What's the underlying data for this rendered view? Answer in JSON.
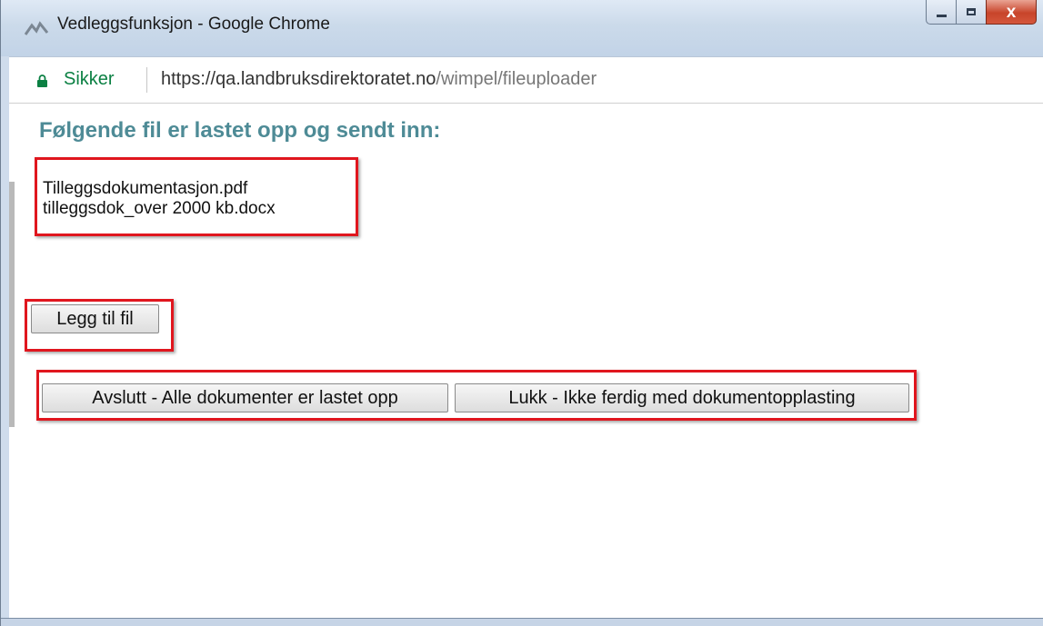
{
  "window": {
    "title": "Vedleggsfunksjon - Google Chrome",
    "controls": {
      "minimize": "minimize",
      "maximize": "maximize",
      "close": "x"
    }
  },
  "addressbar": {
    "secure_label": "Sikker",
    "url_host": "https://qa.landbruksdirektoratet.no",
    "url_path": "/wimpel/fileuploader"
  },
  "page": {
    "heading": "Følgende fil er lastet opp og sendt inn:",
    "files": [
      "Tilleggsdokumentasjon.pdf",
      "tilleggsdok_over 2000 kb.docx"
    ],
    "add_file_label": "Legg til fil",
    "finish_label": "Avslutt - Alle dokumenter er lastet opp",
    "close_label": "Lukk - Ikke ferdig med dokumentopplasting"
  },
  "colors": {
    "heading": "#4e8b96",
    "secure": "#0b8043",
    "highlight": "#e0161e"
  }
}
